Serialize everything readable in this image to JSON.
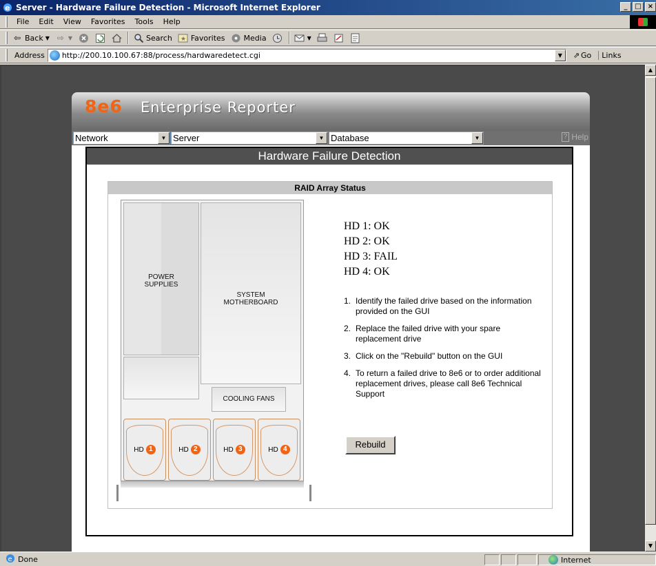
{
  "window": {
    "title": "Server - Hardware Failure Detection - Microsoft Internet Explorer",
    "controls": [
      "_",
      "□",
      "×"
    ]
  },
  "menu": [
    "File",
    "Edit",
    "View",
    "Favorites",
    "Tools",
    "Help"
  ],
  "toolbar": {
    "back": "Back",
    "search": "Search",
    "favorites": "Favorites",
    "media": "Media"
  },
  "address": {
    "label": "Address",
    "url": "http://200.10.100.67:88/process/hardwaredetect.cgi",
    "go": "Go",
    "links": "Links"
  },
  "app": {
    "logo": "8e6",
    "title": "Enterprise Reporter",
    "nav": [
      "Network",
      "Server",
      "Database"
    ],
    "help": "Help",
    "brand_color": "#f06414"
  },
  "page": {
    "title": "Hardware Failure Detection",
    "panel_title": "RAID Array Status",
    "diagram": {
      "power_supplies": [
        "POWER",
        "SUPPLIES"
      ],
      "motherboard": [
        "SYSTEM",
        "MOTHERBOARD"
      ],
      "cooling_fans": "COOLING FANS",
      "hd_label": "HD",
      "drives": [
        "1",
        "2",
        "3",
        "4"
      ]
    },
    "status": [
      "HD 1: OK",
      "HD 2: OK",
      "HD 3: FAIL",
      "HD 4: OK"
    ],
    "instructions": [
      {
        "n": "1.",
        "text": "Identify the failed drive based on the information provided on the GUI"
      },
      {
        "n": "2.",
        "text": "Replace the failed drive with your spare replacement drive"
      },
      {
        "n": "3.",
        "text": "Click on the \"Rebuild\" button on the GUI"
      },
      {
        "n": "4.",
        "text": "To return a failed drive to 8e6 or to order additional replacement drives, please call 8e6 Technical Support"
      }
    ],
    "rebuild_button": "Rebuild"
  },
  "statusbar": {
    "status": "Done",
    "zone": "Internet"
  }
}
